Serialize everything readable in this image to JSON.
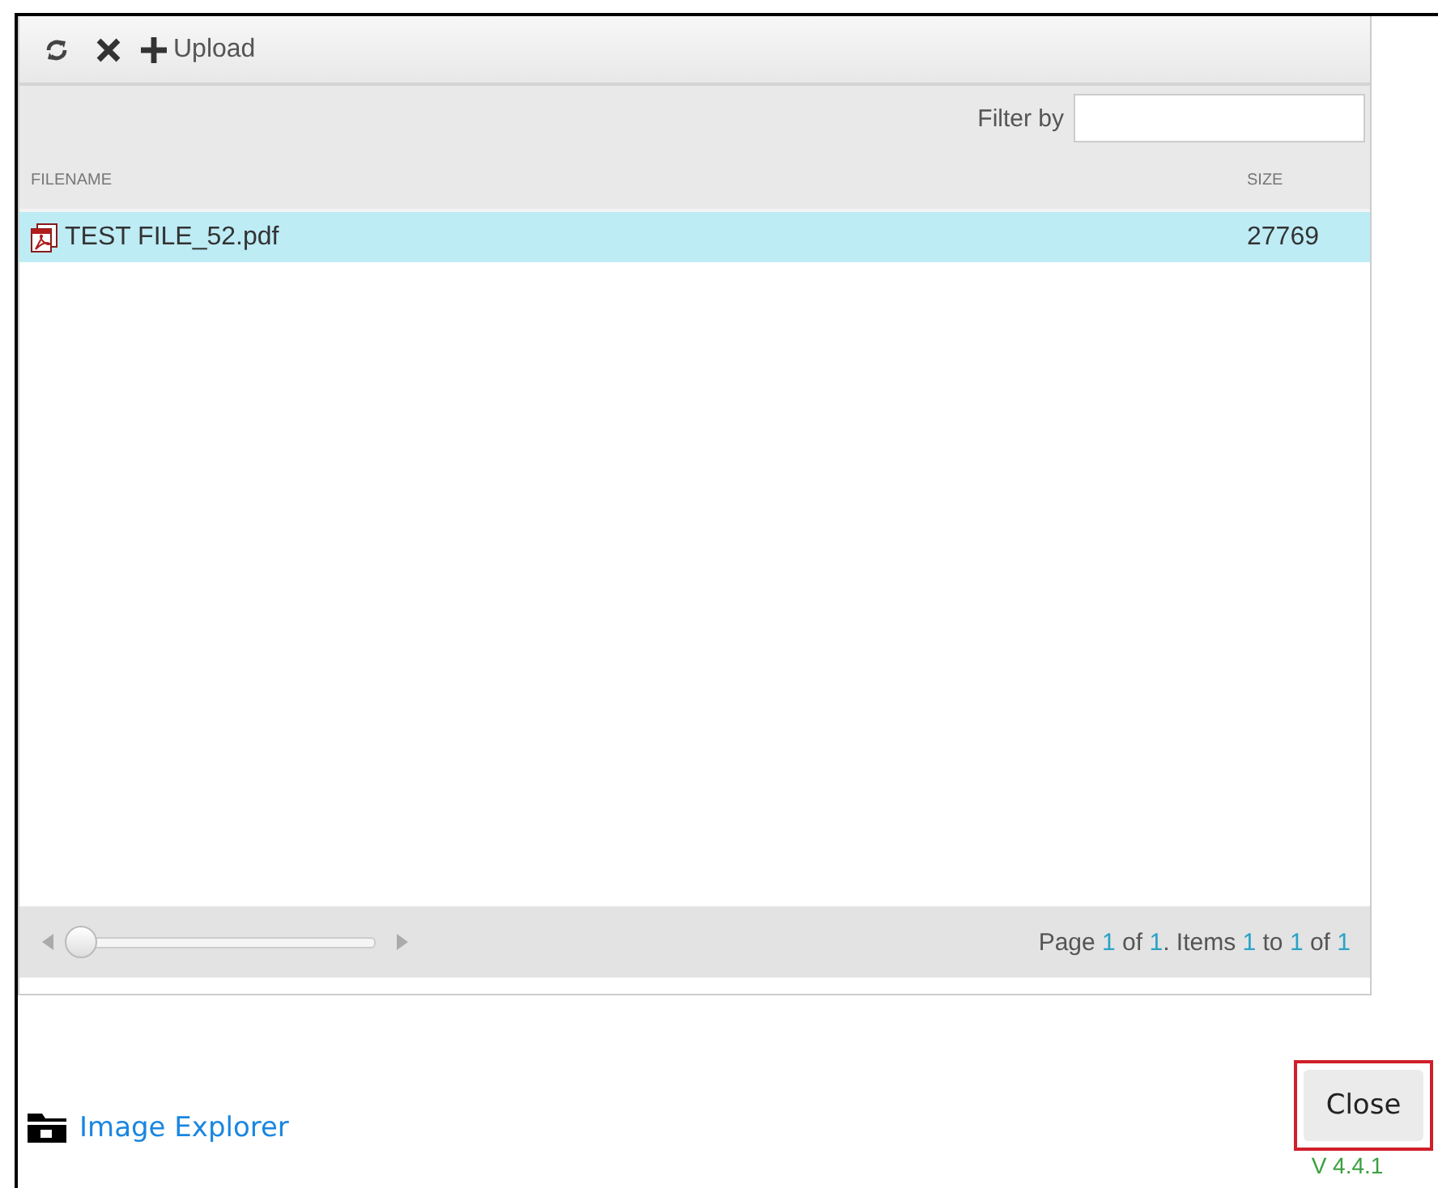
{
  "toolbar": {
    "upload_label": "Upload"
  },
  "filter": {
    "label": "Filter by"
  },
  "table": {
    "columns": [
      "FILENAME",
      "SIZE"
    ],
    "rows": [
      {
        "filename": "TEST FILE_52.pdf",
        "size": "27769",
        "selected": true
      }
    ]
  },
  "pager": {
    "slider": {
      "level": 0
    },
    "info": [
      {
        "text": "Page ",
        "kind": "label"
      },
      {
        "text": "1",
        "kind": "number"
      },
      {
        "text": " of ",
        "kind": "label"
      },
      {
        "text": "1",
        "kind": "number"
      },
      {
        "text": ". Items ",
        "kind": "label"
      },
      {
        "text": "1",
        "kind": "number"
      },
      {
        "text": " to ",
        "kind": "label"
      },
      {
        "text": "1",
        "kind": "number"
      },
      {
        "text": " of ",
        "kind": "label"
      },
      {
        "text": "1",
        "kind": "number"
      }
    ]
  },
  "footer": {
    "link": "Image Explorer",
    "close_button": "Close",
    "version": "V 4.4.1"
  }
}
